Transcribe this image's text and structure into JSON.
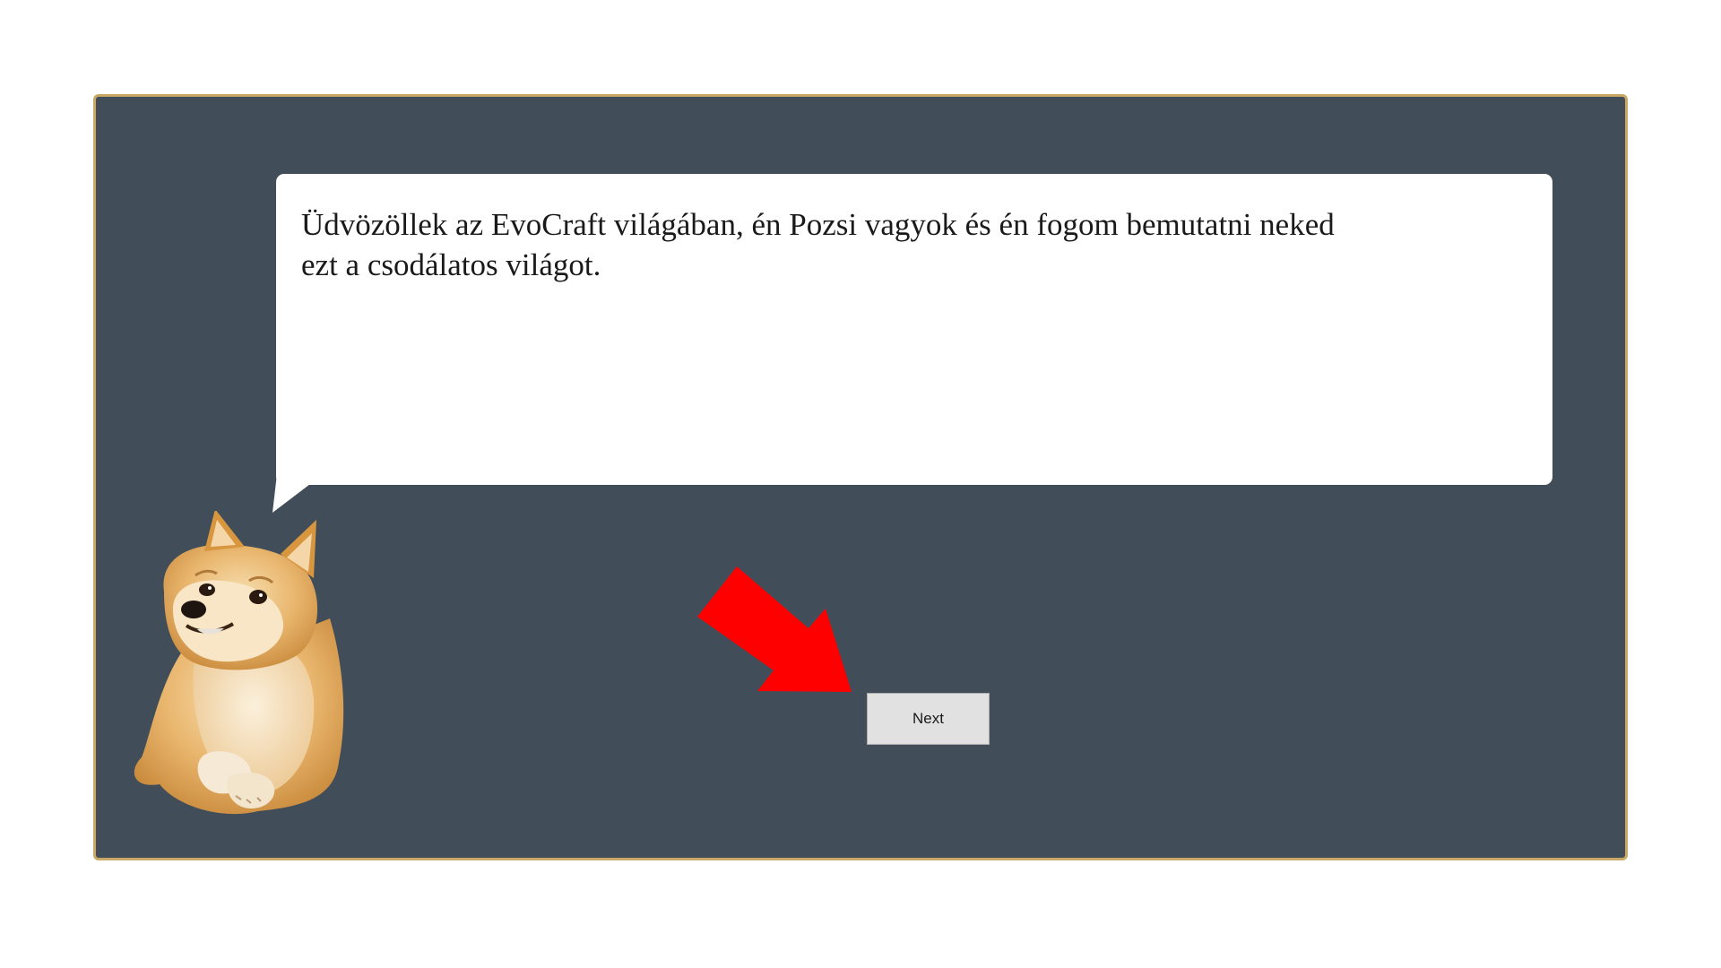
{
  "dialog": {
    "message_lines": [
      "Üdvözöllek az EvoCraft világában, én Pozsi vagyok és én fogom bemutatni neked",
      "ezt a csodálatos világot."
    ]
  },
  "controls": {
    "next_label": "Next"
  },
  "colors": {
    "background": "#414d58",
    "frame_border": "#c9a866",
    "bubble": "#ffffff",
    "arrow": "#ff0000",
    "button": "#e1e1e1"
  },
  "icons": {
    "character": "doge-character",
    "pointer": "red-arrow-icon"
  }
}
